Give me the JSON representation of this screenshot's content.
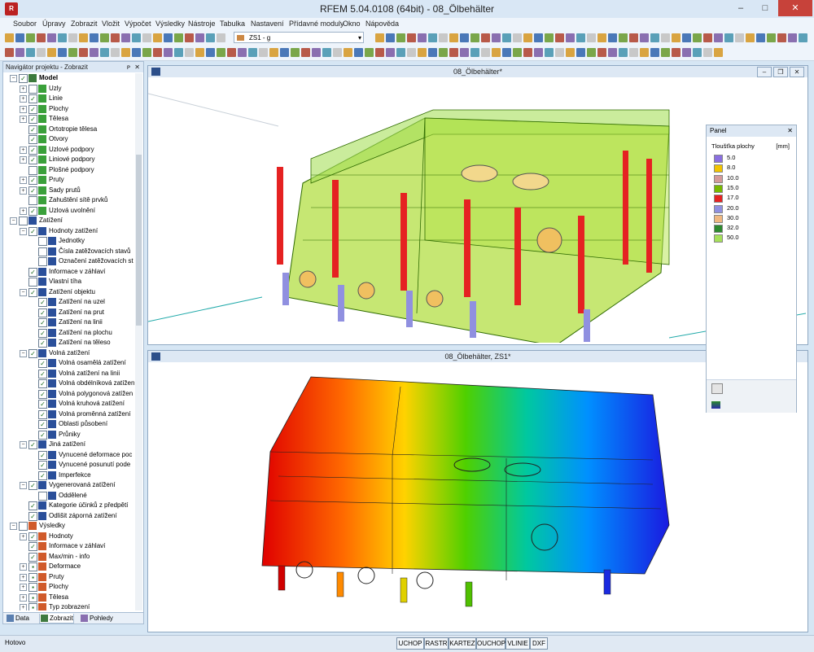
{
  "window": {
    "title": "RFEM 5.04.0108 (64bit) - 08_Ölbehälter",
    "minimize": "–",
    "maximize": "□",
    "close": "✕",
    "logo": "R"
  },
  "menu": [
    "Soubor",
    "Úpravy",
    "Zobrazit",
    "Vložit",
    "Výpočet",
    "Výsledky",
    "Nástroje",
    "Tabulka",
    "Nastavení",
    "Přídavné moduly",
    "Okno",
    "Nápověda"
  ],
  "toolbar": {
    "load_case": "ZS1 - g"
  },
  "navigator": {
    "title": "Navigátor projektu - Zobrazit",
    "pin": "ᴘ",
    "close": "✕",
    "tabs": [
      "Data",
      "Zobrazit",
      "Pohledy"
    ],
    "items": [
      {
        "label": "Model",
        "level": 0,
        "exp": "−",
        "check": "✓",
        "icon": "model",
        "bold": true
      },
      {
        "label": "Uzly",
        "level": 1,
        "exp": "+",
        "check": "",
        "icon": "green"
      },
      {
        "label": "Linie",
        "level": 1,
        "exp": "+",
        "check": "✓",
        "icon": "green"
      },
      {
        "label": "Plochy",
        "level": 1,
        "exp": "+",
        "check": "✓",
        "icon": "green"
      },
      {
        "label": "Tělesa",
        "level": 1,
        "exp": "+",
        "check": "✓",
        "icon": "green"
      },
      {
        "label": "Ortotropie tělesa",
        "level": 1,
        "exp": "",
        "check": "✓",
        "icon": "green"
      },
      {
        "label": "Otvory",
        "level": 1,
        "exp": "",
        "check": "✓",
        "icon": "green"
      },
      {
        "label": "Uzlové podpory",
        "level": 1,
        "exp": "+",
        "check": "✓",
        "icon": "green"
      },
      {
        "label": "Liniové podpory",
        "level": 1,
        "exp": "+",
        "check": "✓",
        "icon": "green"
      },
      {
        "label": "Plošné podpory",
        "level": 1,
        "exp": "",
        "check": "",
        "icon": "green"
      },
      {
        "label": "Pruty",
        "level": 1,
        "exp": "+",
        "check": "✓",
        "icon": "green"
      },
      {
        "label": "Sady prutů",
        "level": 1,
        "exp": "+",
        "check": "✓",
        "icon": "green"
      },
      {
        "label": "Zahuštění sítě prvků",
        "level": 1,
        "exp": "",
        "check": "",
        "icon": "green"
      },
      {
        "label": "Uzlová uvolnění",
        "level": 1,
        "exp": "+",
        "check": "✓",
        "icon": "green"
      },
      {
        "label": "Zatížení",
        "level": 0,
        "exp": "−",
        "check": "",
        "icon": "load"
      },
      {
        "label": "Hodnoty zatížení",
        "level": 1,
        "exp": "−",
        "check": "✓",
        "icon": "load"
      },
      {
        "label": "Jednotky",
        "level": 2,
        "exp": "",
        "check": "",
        "icon": "load"
      },
      {
        "label": "Čísla zatěžovacích stavů",
        "level": 2,
        "exp": "",
        "check": "",
        "icon": "load"
      },
      {
        "label": "Označení zatěžovacích st",
        "level": 2,
        "exp": "",
        "check": "",
        "icon": "load"
      },
      {
        "label": "Informace v záhlaví",
        "level": 1,
        "exp": "",
        "check": "✓",
        "icon": "load"
      },
      {
        "label": "Vlastní tíha",
        "level": 1,
        "exp": "",
        "check": "",
        "icon": "load"
      },
      {
        "label": "Zatížení objektu",
        "level": 1,
        "exp": "−",
        "check": "✓",
        "icon": "load"
      },
      {
        "label": "Zatížení na uzel",
        "level": 2,
        "exp": "",
        "check": "✓",
        "icon": "load"
      },
      {
        "label": "Zatížení na prut",
        "level": 2,
        "exp": "",
        "check": "✓",
        "icon": "load"
      },
      {
        "label": "Zatížení na linii",
        "level": 2,
        "exp": "",
        "check": "✓",
        "icon": "load"
      },
      {
        "label": "Zatížení na plochu",
        "level": 2,
        "exp": "",
        "check": "✓",
        "icon": "load"
      },
      {
        "label": "Zatížení na těleso",
        "level": 2,
        "exp": "",
        "check": "✓",
        "icon": "load"
      },
      {
        "label": "Volná zatížení",
        "level": 1,
        "exp": "−",
        "check": "✓",
        "icon": "load"
      },
      {
        "label": "Volná osamělá zatížení",
        "level": 2,
        "exp": "",
        "check": "✓",
        "icon": "load"
      },
      {
        "label": "Volná zatížení na linii",
        "level": 2,
        "exp": "",
        "check": "✓",
        "icon": "load"
      },
      {
        "label": "Volná obdélníková zatížen",
        "level": 2,
        "exp": "",
        "check": "✓",
        "icon": "load"
      },
      {
        "label": "Volná polygonová zatížen",
        "level": 2,
        "exp": "",
        "check": "✓",
        "icon": "load"
      },
      {
        "label": "Volná kruhová zatížení",
        "level": 2,
        "exp": "",
        "check": "✓",
        "icon": "load"
      },
      {
        "label": "Volná proměnná zatížení",
        "level": 2,
        "exp": "",
        "check": "✓",
        "icon": "load"
      },
      {
        "label": "Oblasti působení",
        "level": 2,
        "exp": "",
        "check": "✓",
        "icon": "load"
      },
      {
        "label": "Průniky",
        "level": 2,
        "exp": "",
        "check": "✓",
        "icon": "load"
      },
      {
        "label": "Jiná zatížení",
        "level": 1,
        "exp": "−",
        "check": "✓",
        "icon": "load"
      },
      {
        "label": "Vynucené deformace poc",
        "level": 2,
        "exp": "",
        "check": "✓",
        "icon": "load"
      },
      {
        "label": "Vynucené posunutí pode",
        "level": 2,
        "exp": "",
        "check": "✓",
        "icon": "load"
      },
      {
        "label": "Imperfekce",
        "level": 2,
        "exp": "",
        "check": "✓",
        "icon": "load"
      },
      {
        "label": "Vygenerovaná zatížení",
        "level": 1,
        "exp": "−",
        "check": "✓",
        "icon": "load"
      },
      {
        "label": "Oddělené",
        "level": 2,
        "exp": "",
        "check": "",
        "icon": "load"
      },
      {
        "label": "Kategorie účinků z předpětí",
        "level": 1,
        "exp": "",
        "check": "✓",
        "icon": "load"
      },
      {
        "label": "Odlišit záporná zatížení",
        "level": 1,
        "exp": "",
        "check": "✓",
        "icon": "load"
      },
      {
        "label": "Výsledky",
        "level": 0,
        "exp": "−",
        "check": "",
        "icon": "res"
      },
      {
        "label": "Hodnoty",
        "level": 1,
        "exp": "+",
        "check": "✓",
        "icon": "res"
      },
      {
        "label": "Informace v záhlaví",
        "level": 1,
        "exp": "",
        "check": "✓",
        "icon": "res"
      },
      {
        "label": "Max/min - info",
        "level": 1,
        "exp": "",
        "check": "✓",
        "icon": "res"
      },
      {
        "label": "Deformace",
        "level": 1,
        "exp": "+",
        "check": "▪",
        "icon": "res"
      },
      {
        "label": "Pruty",
        "level": 1,
        "exp": "+",
        "check": "▪",
        "icon": "res"
      },
      {
        "label": "Plochy",
        "level": 1,
        "exp": "+",
        "check": "▪",
        "icon": "res"
      },
      {
        "label": "Tělesa",
        "level": 1,
        "exp": "+",
        "check": "▪",
        "icon": "res"
      },
      {
        "label": "Typ zobrazení",
        "level": 1,
        "exp": "+",
        "check": "▪",
        "icon": "res"
      }
    ]
  },
  "windows": {
    "top_title": "08_Ölbehälter*",
    "bottom_title": "08_Ölbehälter, ZS1*"
  },
  "panel": {
    "title": "Panel",
    "close": "✕",
    "legend_title": "Tloušťka plochy",
    "unit": "[mm]",
    "legend": [
      {
        "value": "5.0",
        "color": "#8a6fe0"
      },
      {
        "value": "8.0",
        "color": "#f2c400"
      },
      {
        "value": "10.0",
        "color": "#d49a9a"
      },
      {
        "value": "15.0",
        "color": "#78b800"
      },
      {
        "value": "17.0",
        "color": "#e52222"
      },
      {
        "value": "20.0",
        "color": "#9090e0"
      },
      {
        "value": "30.0",
        "color": "#f0b880"
      },
      {
        "value": "32.0",
        "color": "#2e8a2e"
      },
      {
        "value": "50.0",
        "color": "#a6e05a"
      }
    ]
  },
  "status": {
    "text": "Hotovo",
    "buttons": [
      "UCHOP",
      "RASTR",
      "KARTEZ",
      "OUCHOP",
      "VLINIE",
      "DXF"
    ]
  }
}
